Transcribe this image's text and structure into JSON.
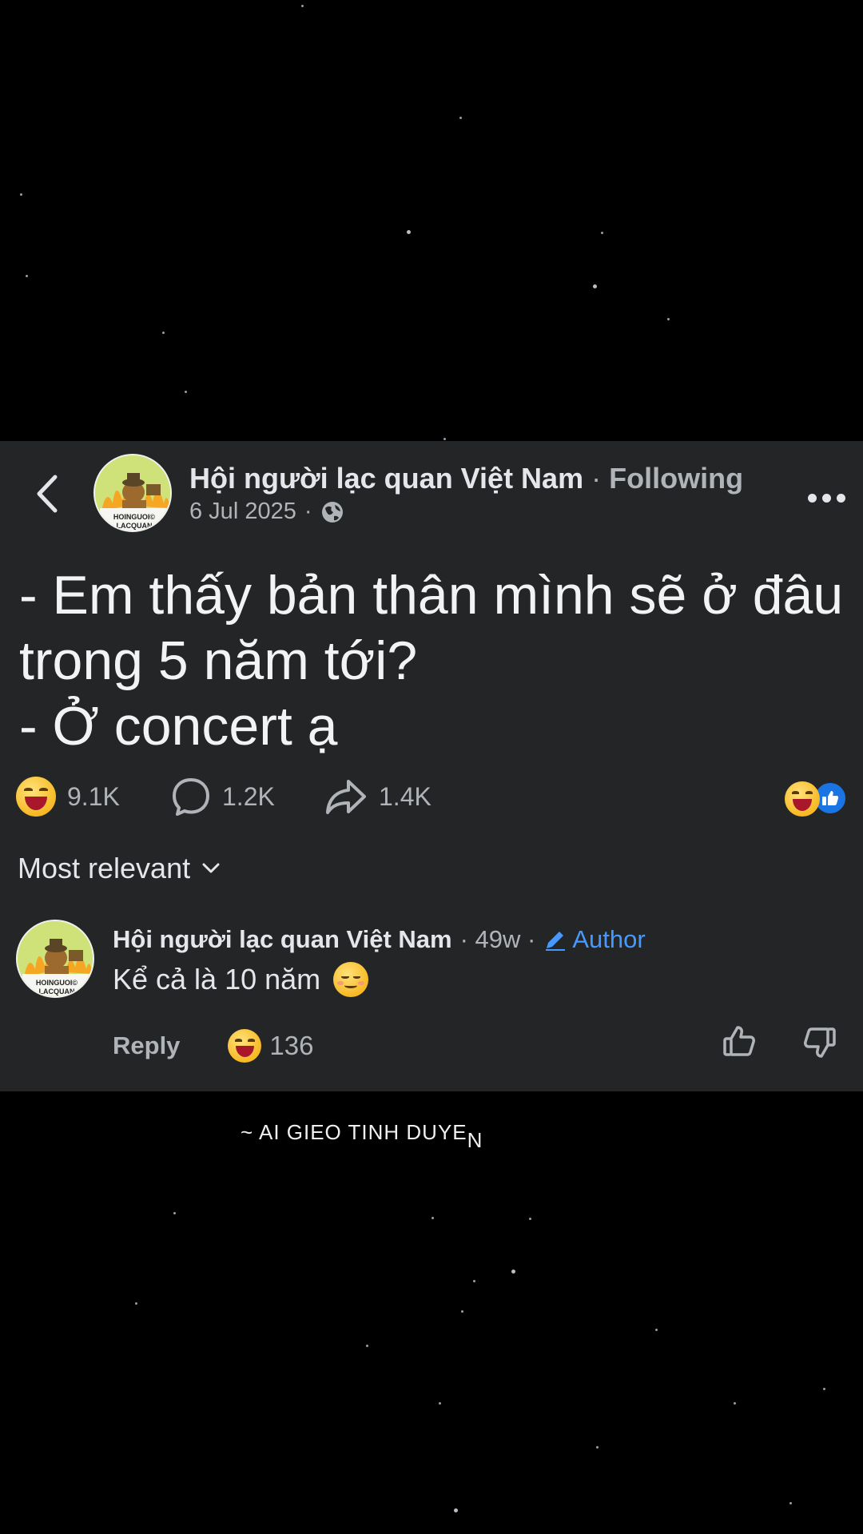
{
  "post": {
    "page_name": "Hội người lạc quan Việt Nam",
    "separator": "·",
    "follow_label": "Following",
    "date": "6 Jul 2025",
    "audience_icon": "globe-icon",
    "avatar_text_1": "HOINGUOI©",
    "avatar_text_2": "LACQUAN",
    "body_lines": [
      "- Em thấy bản thân mình sẽ ở đâu",
      "trong 5 năm tới?",
      "- Ở concert ạ"
    ],
    "reaction_count": "9.1K",
    "comment_count": "1.2K",
    "share_count": "1.4K"
  },
  "sort": {
    "label": "Most relevant"
  },
  "comment": {
    "name": "Hội người lạc quan Việt Nam",
    "time": "· 49w ·",
    "author_label": "Author",
    "text": "Kể cả là 10 năm",
    "reply_label": "Reply",
    "reaction_count": "136"
  },
  "caption": {
    "text": "~ AI GIEO TINH DUYE",
    "drop_letter": "N"
  },
  "colors": {
    "card_bg": "#242526",
    "accent_blue": "#1b74e4",
    "author_blue": "#4599ff",
    "muted": "#b0b3b8"
  }
}
